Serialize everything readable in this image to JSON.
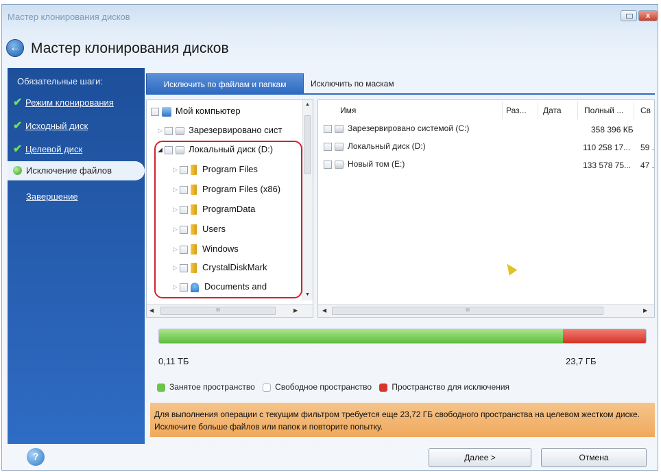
{
  "window": {
    "title": "Мастер клонирования дисков",
    "close_label": "x"
  },
  "header": {
    "title": "Мастер клонирования дисков"
  },
  "sidebar": {
    "title": "Обязательные шаги:",
    "steps": [
      {
        "label": "Режим клонирования",
        "done": true
      },
      {
        "label": "Исходный диск",
        "done": true
      },
      {
        "label": "Целевой диск",
        "done": true
      }
    ],
    "current": "Исключение файлов",
    "last": "Завершение"
  },
  "tabs": {
    "active": "Исключить по файлам и папкам",
    "inactive": "Исключить по маскам"
  },
  "tree": {
    "root": "Мой компьютер",
    "items": [
      {
        "label": "Зарезервировано сист",
        "icon": "drive-icon"
      },
      {
        "label": "Локальный диск (D:)",
        "icon": "drive-icon"
      },
      {
        "label": "Program Files",
        "icon": "folder-icon"
      },
      {
        "label": "Program Files (x86)",
        "icon": "folder-icon"
      },
      {
        "label": "ProgramData",
        "icon": "folder-icon"
      },
      {
        "label": "Users",
        "icon": "folder-icon"
      },
      {
        "label": "Windows",
        "icon": "folder-icon"
      },
      {
        "label": "CrystalDiskMark",
        "icon": "folder-icon"
      },
      {
        "label": "Documents and",
        "icon": "documents-icon"
      }
    ],
    "scroll_label": "III"
  },
  "list": {
    "columns": [
      "Имя",
      "Раз...",
      "Дата",
      "Полный ...",
      "Св"
    ],
    "rows": [
      {
        "name": "Зарезервировано системой (C:)",
        "size": "",
        "date": "",
        "full": "358 396 КБ",
        "free": ""
      },
      {
        "name": "Локальный диск (D:)",
        "size": "",
        "date": "",
        "full": "110 258 17...",
        "free": "59 ."
      },
      {
        "name": "Новый том (E:)",
        "size": "",
        "date": "",
        "full": "133 578 75...",
        "free": "47 ."
      }
    ],
    "scroll_label": "III"
  },
  "space": {
    "min_label": "0,11 ТБ",
    "max_label": "23,7 ГБ",
    "used_fraction": 0.83,
    "excluded_fraction": 0.17,
    "colors": {
      "used": "#6cc44a",
      "free": "#ffffff",
      "excluded": "#d8362c"
    }
  },
  "legend": {
    "used": "Занятое пространство",
    "free": "Свободное пространство",
    "excluded": "Пространство для исключения"
  },
  "warning": {
    "text": "Для выполнения операции с текущим фильтром требуется еще 23,72 ГБ свободного пространства на целевом жестком диске. Исключите больше файлов или папок и повторите попытку."
  },
  "buttons": {
    "next": "Далее >",
    "cancel": "Отмена",
    "help": "?"
  }
}
